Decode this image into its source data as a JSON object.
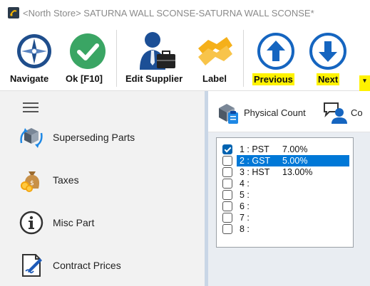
{
  "window": {
    "title": "<North Store> SATURNA WALL SCONSE-SATURNA WALL SCONSE*",
    "app_icon": "app-logo-icon"
  },
  "toolbar": {
    "buttons": [
      {
        "label": "Navigate",
        "icon": "compass-icon"
      },
      {
        "label": "Ok [F10]",
        "icon": "checkmark-icon"
      },
      {
        "label": "Edit Supplier",
        "icon": "supplier-icon"
      },
      {
        "label": "Label",
        "icon": "label-icon"
      },
      {
        "label": "Previous",
        "icon": "arrow-up-icon"
      },
      {
        "label": "Next",
        "icon": "arrow-down-icon"
      }
    ],
    "overflow_glyph": "▾",
    "highlight_color": "#fff200",
    "accent_color": "#1565c0"
  },
  "sidebar": {
    "items": [
      {
        "label": "Superseding Parts",
        "icon": "superseding-parts-icon"
      },
      {
        "label": "Taxes",
        "icon": "money-bag-icon"
      },
      {
        "label": "Misc Part",
        "icon": "info-icon"
      },
      {
        "label": "Contract Prices",
        "icon": "contract-icon"
      }
    ]
  },
  "tabs": [
    {
      "label": "Physical Count",
      "icon": "physical-count-icon"
    },
    {
      "label": "Co",
      "icon": "contacts-icon"
    }
  ],
  "tax_list": {
    "selected_index": 1,
    "items": [
      {
        "num": "1 : PST",
        "value": "7.00%",
        "checked": true
      },
      {
        "num": "2 : GST",
        "value": "5.00%",
        "checked": false
      },
      {
        "num": "3 : HST",
        "value": "13.00%",
        "checked": false
      },
      {
        "num": "4 :",
        "value": "",
        "checked": false
      },
      {
        "num": "5 :",
        "value": "",
        "checked": false
      },
      {
        "num": "6 :",
        "value": "",
        "checked": false
      },
      {
        "num": "7 :",
        "value": "",
        "checked": false
      },
      {
        "num": "8 :",
        "value": "",
        "checked": false
      }
    ]
  }
}
